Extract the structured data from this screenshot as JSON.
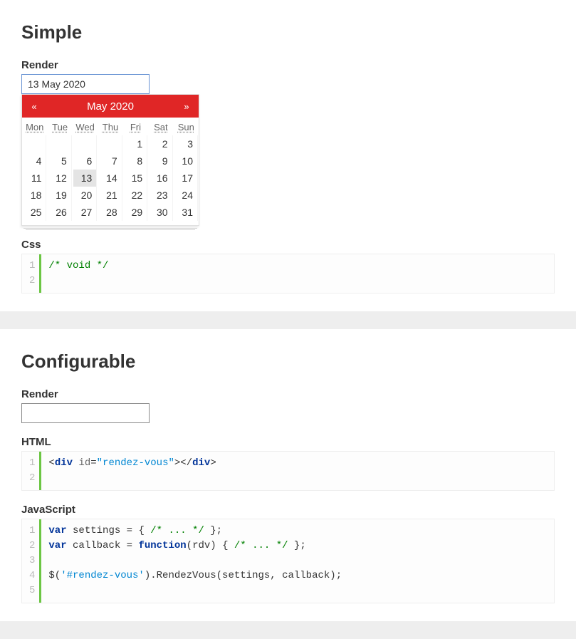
{
  "simple": {
    "title": "Simple",
    "render_label": "Render",
    "input_value": "13 May 2020",
    "css_label": "Css",
    "calendar": {
      "month_title": "May 2020",
      "prev_glyph": "«",
      "next_glyph": "»",
      "dow": [
        "Mon",
        "Tue",
        "Wed",
        "Thu",
        "Fri",
        "Sat",
        "Sun"
      ],
      "leading_blanks": 4,
      "days": 31,
      "selected_day": 13
    },
    "css_code": {
      "lines": [
        "1",
        "2"
      ],
      "comment1": "/* void */"
    }
  },
  "configurable": {
    "title": "Configurable",
    "render_label": "Render",
    "input_value": "",
    "html_label": "HTML",
    "js_label": "JavaScript",
    "html_code": {
      "lines": [
        "1",
        "2"
      ],
      "tok": {
        "lt1": "<",
        "div1": "div",
        "sp_id": " id",
        "eq": "=",
        "idval": "\"rendez-vous\"",
        "gt1": ">",
        "lt2": "</",
        "div2": "div",
        "gt2": ">"
      }
    },
    "js_code": {
      "lines": [
        "1",
        "2",
        "3",
        "4",
        "5"
      ],
      "tok": {
        "var1": "var",
        "sp": " ",
        "settings": "settings = { ",
        "c1": "/* ... */",
        "settings_end": " };",
        "var2": "var",
        "callback": "callback = ",
        "function": "function",
        "callback_args": "(rdv) { ",
        "c2": "/* ... */",
        "callback_end": " };",
        "jq_open": "$(",
        "jq_sel": "'#rendez-vous'",
        "call": ").RendezVous(settings, callback);"
      }
    }
  }
}
